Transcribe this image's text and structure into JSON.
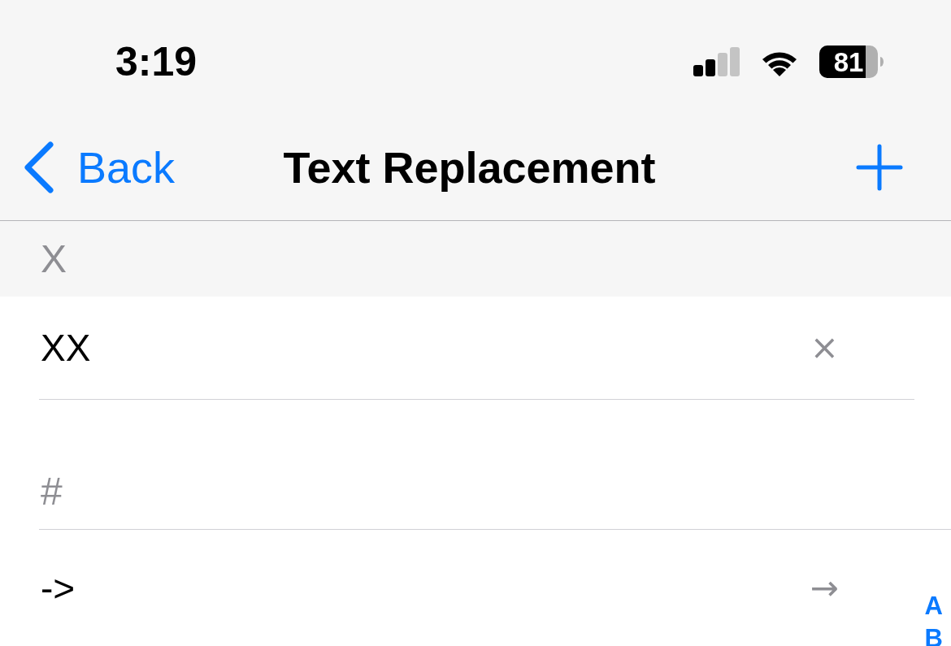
{
  "status_bar": {
    "time": "3:19",
    "battery": "81"
  },
  "nav_bar": {
    "back": "Back",
    "title": "Text Replacement"
  },
  "sections": [
    {
      "header": "X",
      "pinned": true,
      "rows": [
        {
          "label": "XX",
          "detail": "×"
        }
      ]
    },
    {
      "header": "#",
      "pinned": false,
      "rows": [
        {
          "label": "->",
          "detail": "→"
        }
      ]
    }
  ],
  "section_index": [
    "A",
    "B"
  ]
}
